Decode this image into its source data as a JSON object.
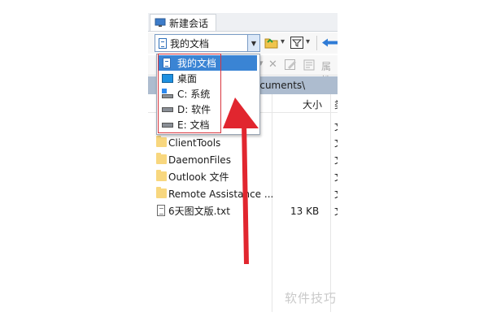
{
  "session_tab": {
    "label": "新建会话"
  },
  "location_combo": {
    "value": "我的文档"
  },
  "path_bar": {
    "text": "ocuments\\"
  },
  "columns": {
    "size": "大小",
    "type_partial": "类"
  },
  "files": [
    {
      "name": "ClientTools",
      "kind": "folder",
      "size": "",
      "type": "文"
    },
    {
      "name": "DaemonFiles",
      "kind": "folder",
      "size": "",
      "type": "文"
    },
    {
      "name": "Outlook 文件",
      "kind": "folder",
      "size": "",
      "type": "文"
    },
    {
      "name": "Remote Assistance ...",
      "kind": "folder",
      "size": "",
      "type": "文"
    },
    {
      "name": "6天图文版.txt",
      "kind": "text",
      "size": "13 KB",
      "type": "文"
    }
  ],
  "dropdown": {
    "items": [
      {
        "label": "我的文档",
        "icon": "documents-icon",
        "selected": true
      },
      {
        "label": "桌面",
        "icon": "desktop-icon",
        "selected": false
      },
      {
        "label": "C: 系统",
        "icon": "drive-c-icon",
        "selected": false
      },
      {
        "label": "D: 软件",
        "icon": "drive-d-icon",
        "selected": false
      },
      {
        "label": "E: 文档",
        "icon": "drive-e-icon",
        "selected": false
      }
    ]
  },
  "toolbar2": {
    "prop_partial": "属性"
  },
  "watermark": "软件技巧",
  "colors": {
    "selection": "#3a84d4",
    "highlight_box": "#d9363e",
    "arrow": "#e1262f",
    "path_bar": "#adbccf"
  }
}
